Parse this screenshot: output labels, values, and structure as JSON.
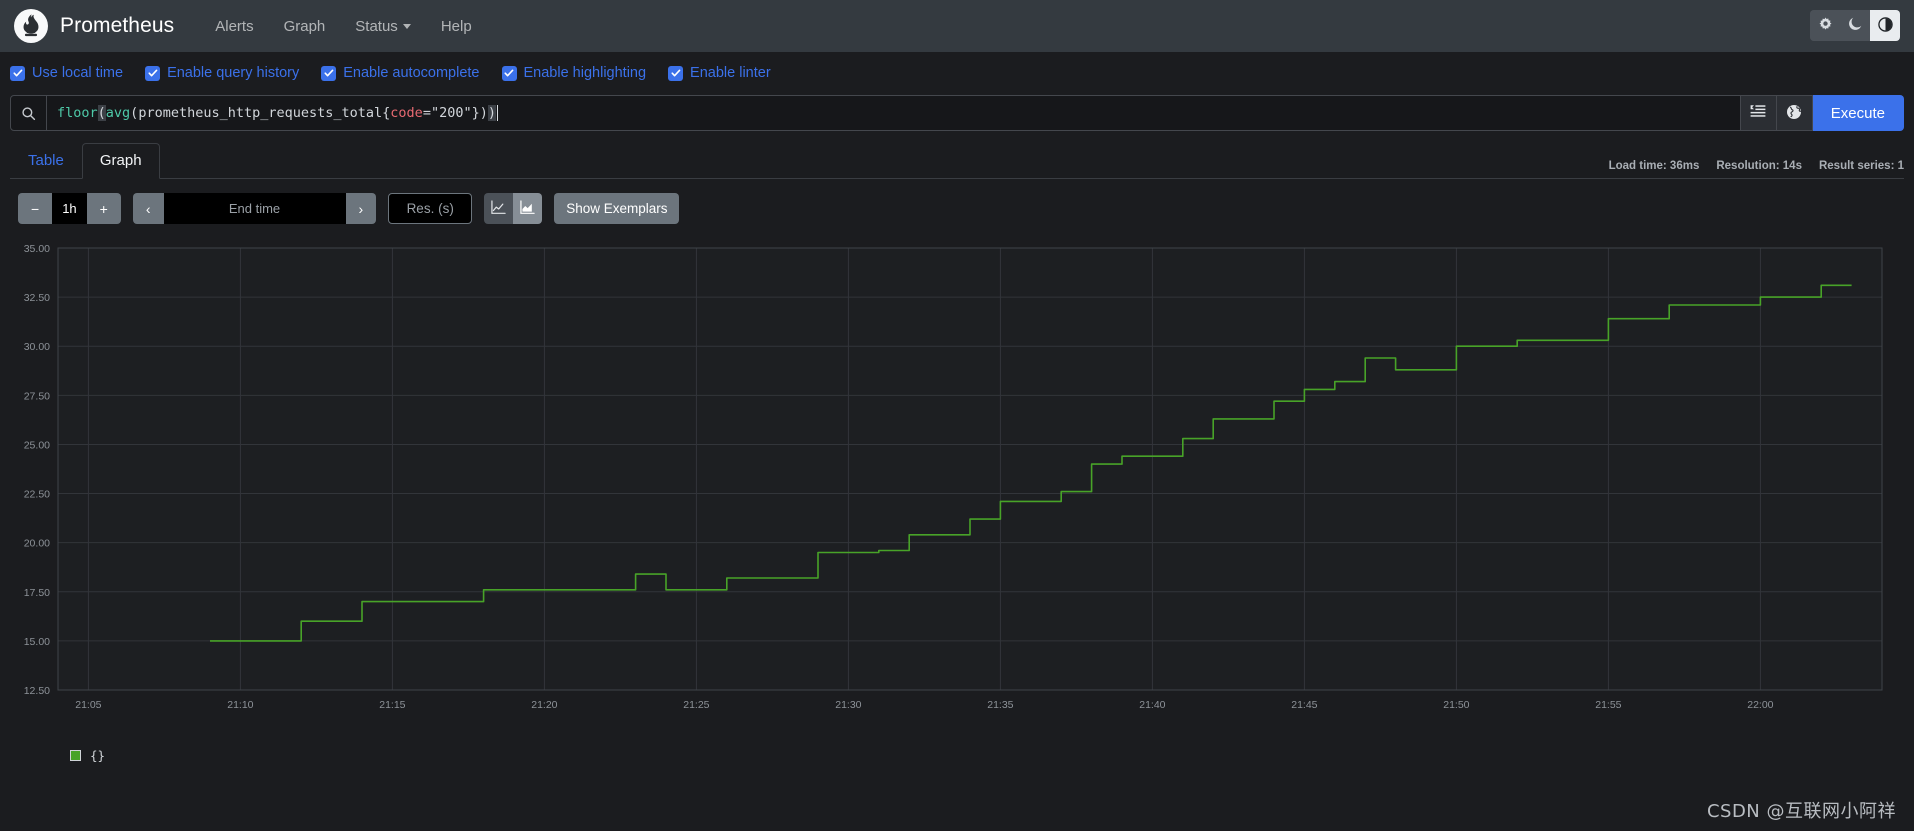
{
  "navbar": {
    "brand": "Prometheus",
    "logo_icon": "prometheus-torch-icon",
    "links": [
      {
        "label": "Alerts",
        "icon": null
      },
      {
        "label": "Graph",
        "icon": null
      },
      {
        "label": "Status",
        "icon": "chevron-down-icon",
        "has_caret": true
      },
      {
        "label": "Help",
        "icon": null
      }
    ],
    "theme_buttons": [
      {
        "name": "light-theme-button",
        "icon": "sun-icon",
        "active": false
      },
      {
        "name": "dark-theme-button",
        "icon": "moon-icon",
        "active": false
      },
      {
        "name": "auto-theme-button",
        "icon": "half-circle-icon",
        "active": true
      }
    ]
  },
  "options": [
    {
      "label": "Use local time",
      "checked": true
    },
    {
      "label": "Enable query history",
      "checked": true
    },
    {
      "label": "Enable autocomplete",
      "checked": true
    },
    {
      "label": "Enable highlighting",
      "checked": true
    },
    {
      "label": "Enable linter",
      "checked": true
    }
  ],
  "query": {
    "search_icon": "search-icon",
    "expression": "floor(avg(prometheus_http_requests_total{code=\"200\"}))",
    "tokens": {
      "floor": "floor",
      "paren1": "(",
      "avg": "avg",
      "paren2": "(",
      "metric": "prometheus_http_requests_total",
      "brace_open": "{",
      "label_name": "code",
      "equals": "=",
      "label_value": "\"200\"",
      "brace_close": "}",
      "paren_close1": ")",
      "paren_close2": ")"
    },
    "format_button_icon": "indent-format-icon",
    "metrics_explorer_icon": "globe-icon",
    "execute_label": "Execute"
  },
  "tabs": [
    {
      "label": "Table",
      "active": false
    },
    {
      "label": "Graph",
      "active": true
    }
  ],
  "stats": {
    "load_time": "Load time: 36ms",
    "resolution": "Resolution: 14s",
    "result_series": "Result series: 1"
  },
  "controls": {
    "decrease_range_label": "−",
    "range_value": "1h",
    "increase_range_label": "+",
    "prev_label": "‹",
    "end_time_placeholder": "End time",
    "end_time_value": "",
    "next_label": "›",
    "resolution_placeholder": "Res. (s)",
    "resolution_value": "",
    "chart_type_line_icon": "line-chart-icon",
    "chart_type_stacked_icon": "stacked-area-chart-icon",
    "chart_type_active": "stacked",
    "show_exemplars_label": "Show Exemplars"
  },
  "legend": [
    {
      "color": "#48a328",
      "label": "{}"
    }
  ],
  "watermark": "CSDN @互联网小阿祥",
  "colors": {
    "accent": "#3b71ea",
    "series": "#48a328",
    "navbar_bg": "#343a40",
    "page_bg": "#1b1c1f",
    "grid": "#32353a"
  },
  "chart_data": {
    "type": "line",
    "title": "",
    "xlabel": "",
    "ylabel": "",
    "grid": true,
    "legend_position": "bottom-left",
    "ylim": [
      12.5,
      35.0
    ],
    "ytick_labels": [
      "35.00",
      "32.50",
      "30.00",
      "27.50",
      "25.00",
      "22.50",
      "20.00",
      "17.50",
      "15.00",
      "12.50"
    ],
    "ytick_values": [
      35.0,
      32.5,
      30.0,
      27.5,
      25.0,
      22.5,
      20.0,
      17.5,
      15.0,
      12.5
    ],
    "xtick_labels": [
      "21:05",
      "21:10",
      "21:15",
      "21:20",
      "21:25",
      "21:30",
      "21:35",
      "21:40",
      "21:45",
      "21:50",
      "21:55",
      "22:00"
    ],
    "xlim": [
      "21:04",
      "22:04"
    ],
    "series": [
      {
        "name": "{}",
        "color": "#48a328",
        "step": true,
        "x": [
          "21:09",
          "21:12",
          "21:12",
          "21:14",
          "21:14",
          "21:18",
          "21:18",
          "21:23",
          "21:23",
          "21:24",
          "21:24",
          "21:26",
          "21:26",
          "21:29",
          "21:29",
          "21:31",
          "21:31",
          "21:32",
          "21:32",
          "21:34",
          "21:34",
          "21:35",
          "21:35",
          "21:37",
          "21:37",
          "21:38",
          "21:38",
          "21:39",
          "21:39",
          "21:41",
          "21:41",
          "21:42",
          "21:42",
          "21:44",
          "21:44",
          "21:45",
          "21:45",
          "21:46",
          "21:46",
          "21:47",
          "21:47",
          "21:48",
          "21:48",
          "21:50",
          "21:50",
          "21:52",
          "21:52",
          "21:55",
          "21:55",
          "21:57",
          "21:57",
          "22:00",
          "22:00",
          "22:02",
          "22:02",
          "22:03"
        ],
        "values": [
          15,
          15,
          16,
          16,
          17,
          17,
          17.6,
          17.6,
          18.4,
          18.4,
          17.6,
          17.6,
          18.2,
          18.2,
          19.5,
          19.5,
          19.6,
          19.6,
          20.4,
          20.4,
          21.2,
          21.2,
          22.1,
          22.1,
          22.6,
          22.6,
          24,
          24,
          24.4,
          24.4,
          25.3,
          25.3,
          26.3,
          26.3,
          27.2,
          27.2,
          27.8,
          27.8,
          28.2,
          28.2,
          29.4,
          29.4,
          28.8,
          28.8,
          30,
          30,
          30.3,
          30.3,
          31.4,
          31.4,
          32.1,
          32.1,
          32.5,
          32.5,
          33.1,
          33.1,
          34.1
        ]
      }
    ]
  }
}
